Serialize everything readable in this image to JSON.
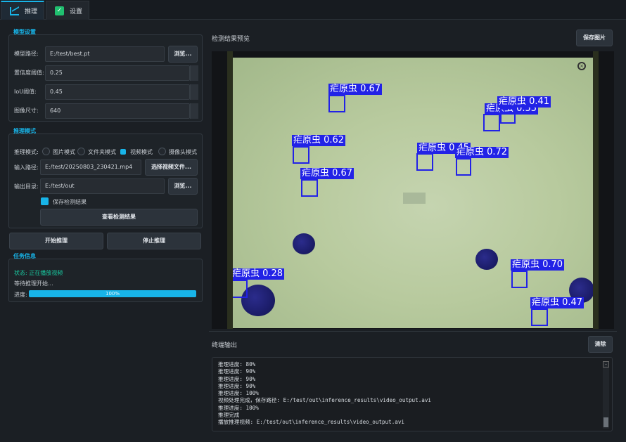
{
  "tabs": [
    {
      "label": "推理",
      "icon": "chart-icon",
      "active": true
    },
    {
      "label": "设置",
      "icon": "checkbox-icon",
      "active": false
    }
  ],
  "model_settings": {
    "title": "模型设置",
    "model_path_label": "模型路径:",
    "model_path_value": "E:/test/best.pt",
    "browse_label": "浏览...",
    "conf_label": "置信度阈值:",
    "conf_value": "0.25",
    "iou_label": "IoU阈值:",
    "iou_value": "0.45",
    "imgsz_label": "图像尺寸:",
    "imgsz_value": "640"
  },
  "inference_mode": {
    "title": "推理模式",
    "mode_label": "推理模式:",
    "modes": [
      "图片模式",
      "文件夹模式",
      "视频模式",
      "摄像头模式"
    ],
    "selected_mode": "视频模式",
    "input_label": "输入路径:",
    "input_value": "E:/test/20250803_230421.mp4",
    "select_video_label": "选择视频文件...",
    "output_label": "输出目录:",
    "output_value": "E:/test/out",
    "browse_label": "浏览...",
    "save_results_label": "保存检测结果",
    "view_results_label": "查看检测结果"
  },
  "actions": {
    "start_label": "开始推理",
    "stop_label": "停止推理"
  },
  "task_info": {
    "title": "任务信息",
    "status_text": "状态: 正在播放视频",
    "waiting_text": "等待推理开始...",
    "progress_label": "进度:",
    "progress_value": 100,
    "progress_text": "100%"
  },
  "preview": {
    "title": "检测结果预览",
    "save_image_label": "保存图片",
    "detections": [
      {
        "label": "疟原虫 0.67"
      },
      {
        "label": "疟原虫 0.41"
      },
      {
        "label": "疟原虫 0.62"
      },
      {
        "label": "疟原虫 0.72"
      },
      {
        "label": "疟原虫 0.67"
      },
      {
        "label": "疟原虫 0.28"
      },
      {
        "label": "疟原虫 0.70"
      },
      {
        "label": "疟原虫 0.47"
      }
    ]
  },
  "terminal": {
    "title": "终端输出",
    "clear_label": "清除",
    "lines": [
      "推理进度: 80%",
      "推理进度: 90%",
      "推理进度: 90%",
      "推理进度: 90%",
      "推理进度: 100%",
      "视频处理完成，保存路径: E:/test/out\\inference_results\\video_output.avi",
      "推理进度: 100%",
      "推理完成",
      "播放推理视频: E:/test/out\\inference_results\\video_output.avi"
    ]
  },
  "colors": {
    "accent": "#18b4e8",
    "bbox": "#2222e6",
    "background": "#1b1f24"
  }
}
